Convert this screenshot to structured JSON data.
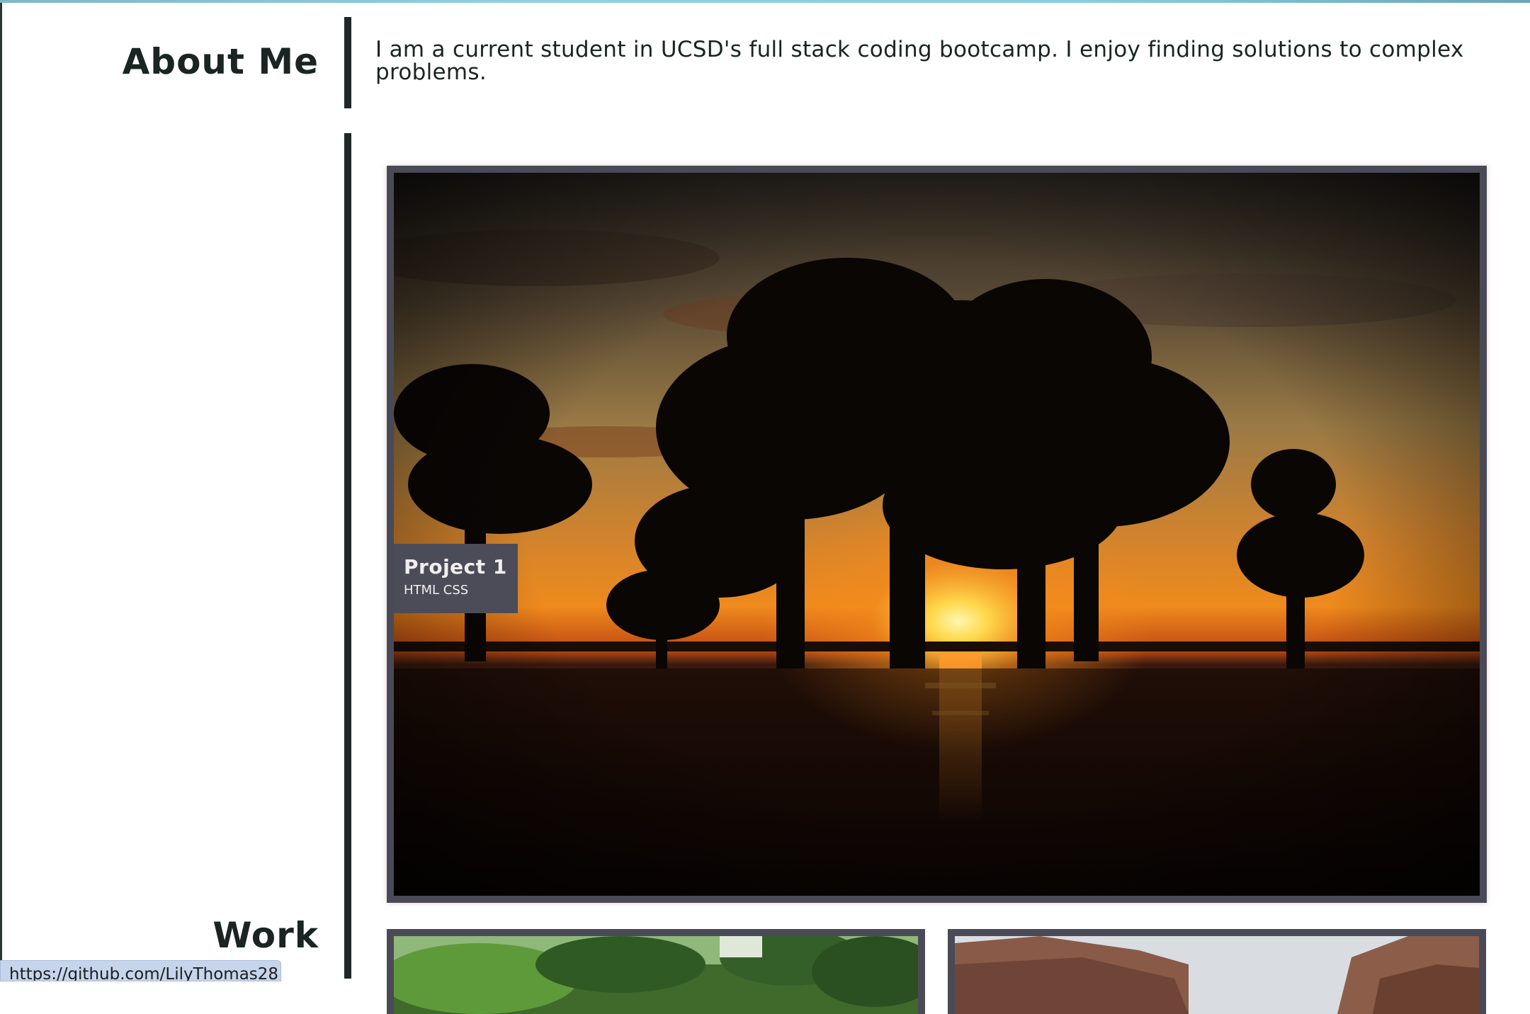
{
  "about": {
    "heading": "About Me",
    "text": "I am a current student in UCSD's full stack coding bootcamp. I enjoy finding solutions to complex problems."
  },
  "work": {
    "heading": "Work",
    "projects": [
      {
        "title": "Project 1",
        "tech": "HTML CSS",
        "image": "sunset-cypress-trees-image"
      },
      {
        "image": "green-grass-forest-image"
      },
      {
        "image": "canyon-rock-cliffs-image"
      }
    ]
  },
  "status_bar": {
    "url": "https://github.com/LilyThomas28"
  },
  "colors": {
    "text": "#1a2422",
    "divider": "#1e2927",
    "card_border": "#4a4a57",
    "label_bg": "#4b4c58",
    "status_bg": "#c6d5ec"
  }
}
